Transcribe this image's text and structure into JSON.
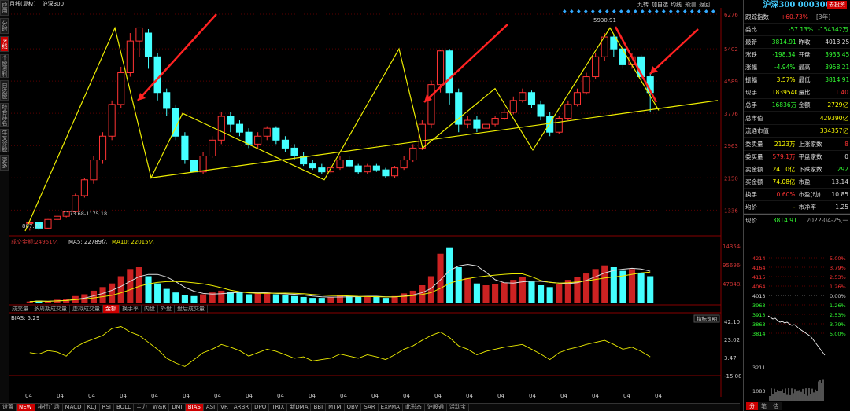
{
  "top": {
    "title1": "月线(复权)",
    "title2": "沪深300",
    "tools": [
      "九转",
      "加自选",
      "均线",
      "预测",
      "返回"
    ]
  },
  "left_tabs": [
    "应用",
    "分时图",
    "K线图",
    "个股资料",
    "自选股",
    "综合排名",
    "牛叉诊股",
    "更多"
  ],
  "chart_data": [
    {
      "type": "candlestick",
      "title": "沪深300 月线(复权)",
      "price_ticks": [
        6276,
        5402,
        4589,
        3776,
        2963,
        2150,
        1336
      ],
      "ylim": [
        807.78,
        6276
      ],
      "annotations": {
        "max": "5930.91",
        "min": "807.78",
        "mid": "1173.68-1175.18"
      },
      "candles": [
        [
          1000,
          1020,
          880,
          820
        ],
        [
          1020,
          880,
          830,
          850
        ],
        [
          880,
          1100,
          1110,
          870
        ],
        [
          1100,
          1180,
          1190,
          1080
        ],
        [
          1180,
          1300,
          1320,
          1150
        ],
        [
          1300,
          1700,
          1750,
          1280
        ],
        [
          1700,
          2100,
          2150,
          1650
        ],
        [
          2100,
          2600,
          2700,
          2000
        ],
        [
          2600,
          3200,
          3300,
          2500
        ],
        [
          3200,
          4000,
          4100,
          3100
        ],
        [
          4000,
          4800,
          4950,
          3900
        ],
        [
          4800,
          5600,
          5800,
          4700
        ],
        [
          5600,
          5930,
          5930,
          5200
        ],
        [
          5800,
          5200,
          5900,
          4900
        ],
        [
          5200,
          4300,
          5300,
          4100
        ],
        [
          4300,
          3900,
          4400,
          3700
        ],
        [
          3900,
          3200,
          4000,
          3100
        ],
        [
          3200,
          2600,
          3300,
          2500
        ],
        [
          2600,
          2300,
          2700,
          2200
        ],
        [
          2300,
          2700,
          2800,
          2250
        ],
        [
          2700,
          3100,
          3200,
          2650
        ],
        [
          3100,
          3700,
          3800,
          3000
        ],
        [
          3700,
          3500,
          3800,
          3300
        ],
        [
          3500,
          3300,
          3600,
          3200
        ],
        [
          3300,
          3000,
          3400,
          2900
        ],
        [
          3000,
          3200,
          3300,
          2900
        ],
        [
          3200,
          3400,
          3450,
          3100
        ],
        [
          3400,
          3100,
          3450,
          3000
        ],
        [
          3100,
          2900,
          3200,
          2800
        ],
        [
          2900,
          2700,
          3000,
          2600
        ],
        [
          2700,
          2500,
          2800,
          2450
        ],
        [
          2500,
          2400,
          2600,
          2350
        ],
        [
          2400,
          2300,
          2500,
          2250
        ],
        [
          2300,
          2400,
          2500,
          2250
        ],
        [
          2400,
          2600,
          2700,
          2350
        ],
        [
          2600,
          2450,
          2700,
          2400
        ],
        [
          2450,
          2300,
          2500,
          2250
        ],
        [
          2300,
          2450,
          2500,
          2250
        ],
        [
          2450,
          2350,
          2500,
          2300
        ],
        [
          2350,
          2200,
          2400,
          2150
        ],
        [
          2200,
          2400,
          2450,
          2150
        ],
        [
          2400,
          2600,
          2700,
          2350
        ],
        [
          2600,
          2900,
          3000,
          2550
        ],
        [
          2900,
          3500,
          3600,
          2850
        ],
        [
          3500,
          4500,
          4600,
          3400
        ],
        [
          4500,
          5350,
          5380,
          4300
        ],
        [
          5350,
          4300,
          5400,
          4000
        ],
        [
          4300,
          3500,
          4400,
          3300
        ],
        [
          3500,
          3600,
          3700,
          3400
        ],
        [
          3600,
          3400,
          3700,
          3300
        ],
        [
          3400,
          3500,
          3600,
          3350
        ],
        [
          3500,
          3650,
          3700,
          3450
        ],
        [
          3650,
          3800,
          3900,
          3600
        ],
        [
          3800,
          4100,
          4200,
          3750
        ],
        [
          4100,
          4300,
          4400,
          4050
        ],
        [
          4300,
          4000,
          4350,
          3900
        ],
        [
          4000,
          3700,
          4100,
          3600
        ],
        [
          3700,
          3300,
          3800,
          3200
        ],
        [
          3300,
          3650,
          3700,
          3250
        ],
        [
          3650,
          4000,
          4100,
          3600
        ],
        [
          4000,
          4300,
          4400,
          3950
        ],
        [
          4300,
          4700,
          4800,
          4250
        ],
        [
          4700,
          5200,
          5300,
          4650
        ],
        [
          5200,
          5700,
          5800,
          5100
        ],
        [
          5700,
          5400,
          5750,
          5200
        ],
        [
          5400,
          5000,
          5500,
          4900
        ],
        [
          5000,
          5200,
          5300,
          4900
        ],
        [
          5200,
          4700,
          5250,
          4600
        ],
        [
          4700,
          4300,
          4800,
          3814
        ]
      ],
      "trend_lines": "yellow zigzag and rising support line",
      "arrows": 4
    },
    {
      "type": "bar",
      "title": "成交金额",
      "legend": [
        "成交金额:24951亿",
        "MA5: 22789亿",
        "MA10: 22015亿"
      ],
      "yticks": [
        "14354449",
        "9569663",
        "4784832"
      ]
    },
    {
      "type": "line",
      "title": "BIAS: 5.29",
      "legend": [
        "BIAS: 5.29"
      ],
      "yticks": [
        "42.10",
        "23.02",
        "3.47",
        "-15.08"
      ]
    }
  ],
  "volume_tabs": [
    "成交量",
    "多周期成交量",
    "虚拟成交量",
    "金额",
    "换手率",
    "内盘",
    "外盘",
    "盘后成交量"
  ],
  "bias_link": "指标说明",
  "x_labels": [
    "04",
    "04",
    "04",
    "04",
    "04",
    "04",
    "04",
    "04",
    "04",
    "04",
    "04",
    "04",
    "04",
    "04",
    "04",
    "04",
    "04",
    "04",
    "04",
    "04",
    "04"
  ],
  "bottom_tabs": [
    "设置",
    "NEW",
    "排行广场",
    "MACD",
    "KDJ",
    "RSI",
    "BOLL",
    "主力",
    "W&R",
    "DMI",
    "BIAS",
    "ASI",
    "VR",
    "ARBR",
    "DPO",
    "TRIX",
    "新DMA",
    "BBI",
    "MTM",
    "OBV",
    "SAR",
    "EXPMA",
    "此形态",
    "沪股通",
    "活动宝"
  ],
  "panel": {
    "title": "沪深300 000300",
    "title_btn": "去投资",
    "track": [
      "跟踪指数",
      "+60.73%",
      "[3年]"
    ],
    "rows": [
      [
        "委比",
        "-57.13%",
        "-154342万"
      ],
      [
        "最新",
        "3814.91",
        "昨收",
        "4013.25"
      ],
      [
        "涨跌",
        "-198.34",
        "开盘",
        "3933.45"
      ],
      [
        "涨幅",
        "-4.94%",
        "最高",
        "3958.21"
      ],
      [
        "振幅",
        "3.57%",
        "最低",
        "3814.91"
      ],
      [
        "现手",
        "1839540",
        "量比",
        "1.40"
      ],
      [
        "总手",
        "16836万",
        "金额",
        "2729亿"
      ]
    ],
    "market": [
      [
        "总市值",
        "429390亿"
      ],
      [
        "流通市值",
        "334357亿"
      ]
    ],
    "stats": [
      [
        "委卖量",
        "2123万",
        "上涨家数",
        "8"
      ],
      [
        "委买量",
        "579.1万",
        "平盘家数",
        "0"
      ],
      [
        "卖金额",
        "241.0亿",
        "下跌家数",
        "292"
      ],
      [
        "买金额",
        "74.08亿",
        "市盈",
        "13.14"
      ],
      [
        "换手",
        "0.60%",
        "市盈(动)",
        "10.85"
      ],
      [
        "均价",
        "-",
        "市净率",
        "1.25"
      ]
    ],
    "now_label": "现价",
    "now_val": "3814.91",
    "date": "2022-04-25,一",
    "mini_left": [
      "4214",
      "4164",
      "4115",
      "4064",
      "4013",
      "3963",
      "3913",
      "3863",
      "3814"
    ],
    "mini_right": [
      "5.00%",
      "3.79%",
      "2.53%",
      "1.26%",
      "0.00%",
      "1.26%",
      "2.53%",
      "3.79%",
      "5.00%"
    ],
    "mini_vol": [
      "3211",
      "1083"
    ],
    "mini_tabs": [
      "分",
      "笔",
      "估"
    ]
  }
}
